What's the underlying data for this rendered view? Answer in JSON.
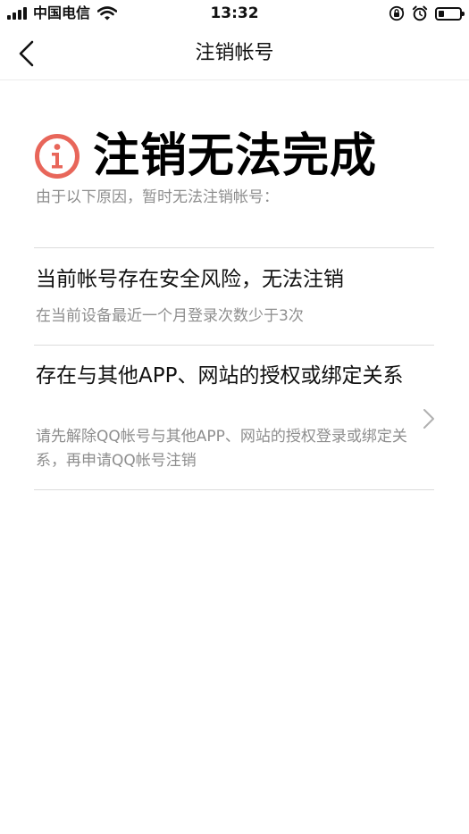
{
  "status_bar": {
    "carrier": "中国电信",
    "time": "13:32",
    "battery_level": 0.28
  },
  "nav": {
    "title": "注销帐号"
  },
  "main": {
    "heading": "注销无法完成",
    "subtitle": "由于以下原因，暂时无法注销帐号：",
    "accent_color": "#e8665a",
    "reasons": [
      {
        "title": "当前帐号存在安全风险，无法注销",
        "description": "在当前设备最近一个月登录次数少于3次"
      },
      {
        "title": "存在与其他APP、网站的授权或绑定关系",
        "description": "请先解除QQ帐号与其他APP、网站的授权登录或绑定关系，再申请QQ帐号注销"
      }
    ]
  }
}
